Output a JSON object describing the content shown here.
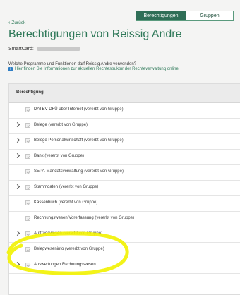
{
  "tabs": {
    "active": "Berechtigungen",
    "inactive": "Gruppen"
  },
  "back": {
    "chevron": "‹",
    "label": "Zurück"
  },
  "page": {
    "title": "Berechtigungen von Reissig Andre",
    "smartcard_label": "SmartCard: "
  },
  "question": "Welche Programme und Funktionen darf Reissig Andre verwenden?",
  "info": {
    "icon": "i",
    "link": "Hier finden Sie Informationen zur aktuellen Rechtestruktur der Rechteverwaltung online"
  },
  "table": {
    "header": "Berechtigung",
    "rows": [
      {
        "label": "DATEV-DFÜ über Internet",
        "suffix": "(vererbt von Gruppe)",
        "expandable": false
      },
      {
        "label": "Belege",
        "suffix": "(vererbt von Gruppe)",
        "expandable": true
      },
      {
        "label": "Belege Personalwirtschaft",
        "suffix": "(vererbt von Gruppe)",
        "expandable": true
      },
      {
        "label": "Bank",
        "suffix": "(vererbt von Gruppe)",
        "expandable": true
      },
      {
        "label": "SEPA-Mandatsverwaltung",
        "suffix": "(vererbt von Gruppe)",
        "expandable": false
      },
      {
        "label": "Stammdaten",
        "suffix": "(vererbt von Gruppe)",
        "expandable": true
      },
      {
        "label": "Kassenbuch",
        "suffix": "(vererbt von Gruppe)",
        "expandable": false
      },
      {
        "label": "Rechnungswesen Vorerfassung",
        "suffix": "(vererbt von Gruppe)",
        "expandable": false
      },
      {
        "label": "Auftragswesen",
        "suffix": "(vererbt von Gruppe)",
        "expandable": true
      },
      {
        "label": "Belegweseninfo",
        "suffix": "(vererbt von Gruppe)",
        "expandable": false
      },
      {
        "label": "Auswertungen Rechnungswesen",
        "suffix": "",
        "expandable": true
      }
    ]
  },
  "colors": {
    "accent": "#2e7858",
    "highlight": "#f2f200"
  }
}
